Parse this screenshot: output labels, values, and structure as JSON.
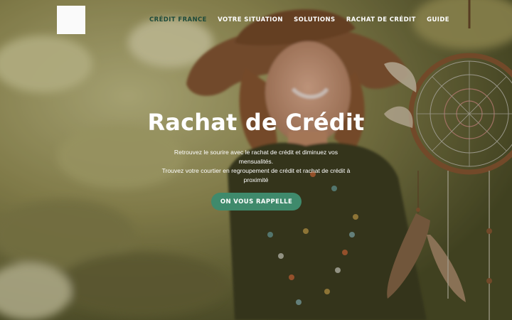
{
  "nav": {
    "items": [
      {
        "label": "CRÉDIT FRANCE",
        "active": true
      },
      {
        "label": "VOTRE SITUATION"
      },
      {
        "label": "SOLUTIONS"
      },
      {
        "label": "RACHAT DE CRÉDIT"
      },
      {
        "label": "GUIDE"
      }
    ]
  },
  "hero": {
    "title": "Rachat de Crédit",
    "text_line1": "Retrouvez le sourire avec le rachat de crédit et diminuez vos mensualités.",
    "text_line2": "Trouvez votre courtier en regroupement de crédit et rachat de crédit à",
    "text_line3": "proximité",
    "cta_label": "ON VOUS RAPPELLE"
  },
  "colors": {
    "cta": "#3f8a6c",
    "active_nav": "#1d4a3a"
  }
}
